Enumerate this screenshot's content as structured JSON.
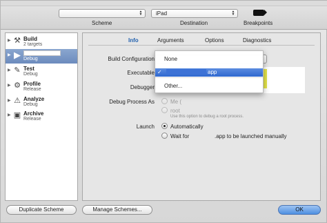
{
  "toolbar": {
    "scheme_label": "Scheme",
    "destination_label": "Destination",
    "breakpoints_label": "Breakpoints",
    "destination_value": "iPad",
    "scheme_value": ""
  },
  "sidebar": {
    "items": [
      {
        "title": "Build",
        "subtitle": "2 targets",
        "icon": "hammer-icon",
        "glyph": "⚒"
      },
      {
        "title": "",
        "subtitle": "Debug",
        "icon": "run-icon",
        "glyph": "▶"
      },
      {
        "title": "Test",
        "subtitle": "Debug",
        "icon": "wrench-icon",
        "glyph": "🔧"
      },
      {
        "title": "Profile",
        "subtitle": "Release",
        "icon": "profile-icon",
        "glyph": "⚙"
      },
      {
        "title": "Analyze",
        "subtitle": "Debug",
        "icon": "analyze-icon",
        "glyph": "⚠"
      },
      {
        "title": "Archive",
        "subtitle": "Release",
        "icon": "archive-icon",
        "glyph": "▣"
      }
    ]
  },
  "tabs": [
    "Info",
    "Arguments",
    "Options",
    "Diagnostics"
  ],
  "form": {
    "build_configuration_label": "Build Configuration",
    "executable_label": "Executable",
    "debugger_label": "Debugger",
    "debug_process_as_label": "Debug Process As",
    "me_option": "Me (",
    "root_option": "root",
    "root_hint": "Use this option to debug a root process.",
    "launch_label": "Launch",
    "automatically_option": "Automatically",
    "wait_for_option_prefix": "Wait for",
    "wait_for_option_suffix": ".app to be launched manually"
  },
  "dropdown": {
    "items": [
      "None",
      "app",
      "Other..."
    ],
    "selected_index": 1,
    "checkmark": "✓"
  },
  "buttons": {
    "duplicate": "Duplicate Scheme",
    "manage": "Manage Schemes...",
    "ok": "OK"
  },
  "colors": {
    "selection": "#7694c6",
    "active_tab": "#1f5fae",
    "menu_highlight": "#3d72d6"
  }
}
